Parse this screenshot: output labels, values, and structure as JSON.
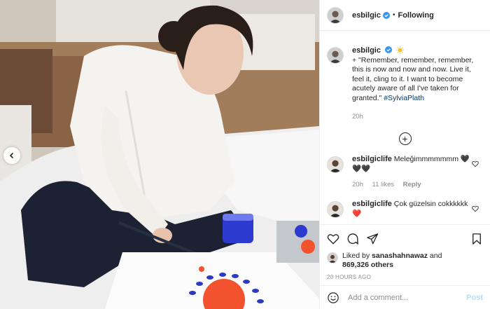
{
  "header": {
    "username": "esbilgic",
    "separator": "•",
    "follow_state": "Following"
  },
  "caption": {
    "username": "esbilgic",
    "text": "+ \"Remember, remember, remember, this is now and now and now. Live it, feel it, cling to it. I want to become acutely aware of all I've taken for granted.\" ",
    "hashtag": "#SylviaPlath",
    "time": "20h"
  },
  "comments": [
    {
      "username": "esbilgiclife",
      "text": "Meleğimmmmmmm 🖤🖤🖤",
      "time": "20h",
      "likes": "11 likes",
      "reply": "Reply"
    },
    {
      "username": "esbilgiclife",
      "text": "Çok güzelsin cokkkkkk❤️",
      "time": "",
      "likes": "",
      "reply": ""
    }
  ],
  "likes": {
    "prefix": "Liked by ",
    "user": "sanashahnawaz",
    "connector": " and",
    "others": "869,326 others"
  },
  "time_ago": "20 HOURS AGO",
  "add_comment": {
    "placeholder": "Add a comment...",
    "post_label": "Post"
  },
  "colors": {
    "verified": "#3897f0",
    "link": "#00376b",
    "muted": "#8e8e8e",
    "post_disabled": "#b2dffc"
  },
  "icons": [
    "chevron-left-icon",
    "verified-icon",
    "sun-emoji-icon",
    "add-circle-icon",
    "heart-icon",
    "comment-icon",
    "share-icon",
    "bookmark-icon",
    "emoji-icon"
  ]
}
